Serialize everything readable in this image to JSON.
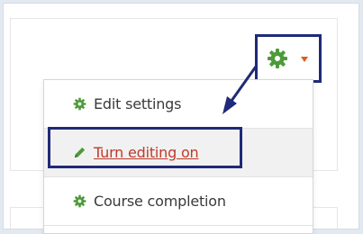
{
  "toolbar": {
    "gear_icon": "gear-icon",
    "caret_icon": "caret-down-icon",
    "gear_color": "#4e9a3a",
    "caret_color": "#e05a1c"
  },
  "menu": {
    "items": [
      {
        "label": "Edit settings",
        "icon": "gear-icon",
        "icon_color": "#4e9a3a"
      },
      {
        "label": "Turn editing on",
        "icon": "pencil-icon",
        "icon_color": "#4e9a3a",
        "text_color": "#c0392b"
      },
      {
        "label": "Course completion",
        "icon": "gear-icon",
        "icon_color": "#4e9a3a"
      }
    ]
  },
  "annotation": {
    "highlight_color": "#1f2a78"
  }
}
